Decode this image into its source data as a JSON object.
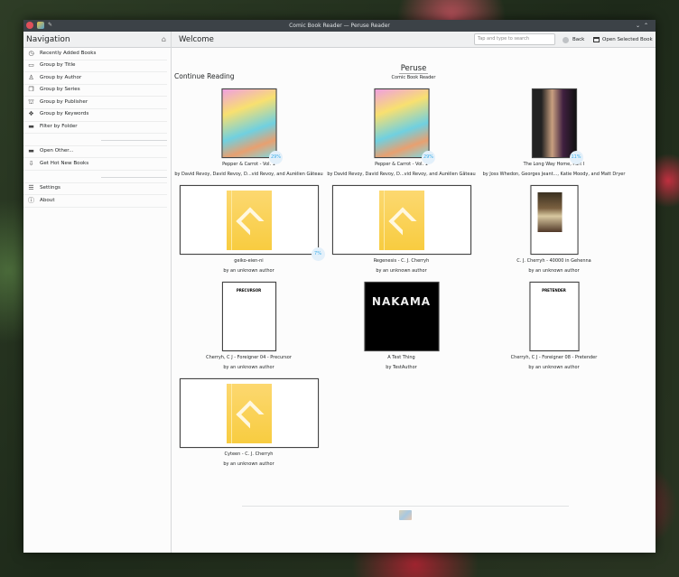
{
  "window": {
    "title": "Comic Book Reader — Peruse Reader"
  },
  "sidebar": {
    "title": "Navigation",
    "items": [
      {
        "label": "Recently Added Books",
        "icon": "clock-icon"
      },
      {
        "label": "Group by Title",
        "icon": "title-icon"
      },
      {
        "label": "Group by Author",
        "icon": "user-icon"
      },
      {
        "label": "Group by Series",
        "icon": "series-icon"
      },
      {
        "label": "Group by Publisher",
        "icon": "publisher-icon"
      },
      {
        "label": "Group by Keywords",
        "icon": "tag-icon"
      },
      {
        "label": "Filter by Folder",
        "icon": "folder-icon"
      }
    ],
    "items2": [
      {
        "label": "Open Other...",
        "icon": "folder-icon"
      },
      {
        "label": "Get Hot New Books",
        "icon": "download-icon"
      }
    ],
    "items3": [
      {
        "label": "Settings",
        "icon": "sliders-icon"
      },
      {
        "label": "About",
        "icon": "info-icon"
      }
    ]
  },
  "header": {
    "title": "Welcome",
    "search_placeholder": "Tap and type to search",
    "back": "Back",
    "open": "Open Selected Book"
  },
  "brand": {
    "name": "Peruse",
    "subtitle": "Comic Book Reader"
  },
  "section": "Continue Reading",
  "books": [
    {
      "title": "Pepper & Carrot - Vol. 1",
      "author": "by David Revoy, David Revoy, D...vid Revoy, and Aurélien Gâteau",
      "progress": "29%",
      "cover": "pepper"
    },
    {
      "title": "Pepper & Carrot - Vol. 1",
      "author": "by David Revoy, David Revoy, D...vid Revoy, and Aurélien Gâteau",
      "progress": "29%",
      "cover": "pepper"
    },
    {
      "title": "The Long Way Home, Part I",
      "author": "by Joss Whedon, Georges Jeant..., Katie Moody, and Matt Dryer",
      "progress": "11%",
      "cover": "dark"
    },
    {
      "title": "geiko-eien-ni",
      "author": "by an unknown author",
      "progress": "7%",
      "cover": "epub"
    },
    {
      "title": "Regenesis - C. J. Cherryh",
      "author": "by an unknown author",
      "cover": "epub"
    },
    {
      "title": "C. J. Cherryh - 40000 in Gehenna",
      "author": "by an unknown author",
      "cover": "gehenna"
    },
    {
      "title": "Cherryh, C J - Foreigner 04 - Precursor",
      "author": "by an unknown author",
      "cover": "page",
      "cover_text": "PRECURSOR"
    },
    {
      "title": "A Test Thing",
      "author": "by TestAuthor",
      "cover": "nakama",
      "cover_text": "NAKAMA"
    },
    {
      "title": "Cherryh, C J - Foreigner 08 - Pretender",
      "author": "by an unknown author",
      "cover": "page2",
      "cover_text": "PRETENDER"
    },
    {
      "title": "Cyteen - C. J. Cherryh",
      "author": "by an unknown author",
      "cover": "epub"
    }
  ]
}
